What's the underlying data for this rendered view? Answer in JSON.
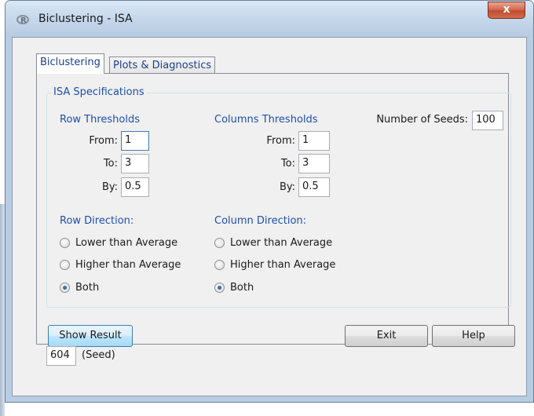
{
  "window": {
    "title": "Biclustering - ISA",
    "close_glyph": "x",
    "icon": "r-logo-icon"
  },
  "tabs": [
    {
      "label": "Biclustering",
      "active": true
    },
    {
      "label": "Plots & Diagnostics",
      "active": false
    }
  ],
  "isa": {
    "group_title": "ISA Specifications",
    "row_thresholds": {
      "title": "Row Thresholds",
      "from_label": "From:",
      "from_value": "1",
      "to_label": "To:",
      "to_value": "3",
      "by_label": "By:",
      "by_value": "0.5"
    },
    "column_thresholds": {
      "title": "Columns Thresholds",
      "from_label": "From:",
      "from_value": "1",
      "to_label": "To:",
      "to_value": "3",
      "by_label": "By:",
      "by_value": "0.5"
    },
    "seeds": {
      "label": "Number of Seeds:",
      "value": "100"
    },
    "row_direction": {
      "title": "Row Direction:",
      "options": [
        "Lower than Average",
        "Higher than Average",
        "Both"
      ],
      "selected": "Both"
    },
    "column_direction": {
      "title": "Column Direction:",
      "options": [
        "Lower than Average",
        "Higher than Average",
        "Both"
      ],
      "selected": "Both"
    }
  },
  "buttons": {
    "show_result": "Show Result",
    "exit": "Exit",
    "help": "Help"
  },
  "seed": {
    "value": "604",
    "label": "(Seed)"
  },
  "colors": {
    "label_blue": "#1e4fae",
    "frame_blue": "#b8cde3",
    "close_red": "#c14b2f"
  }
}
